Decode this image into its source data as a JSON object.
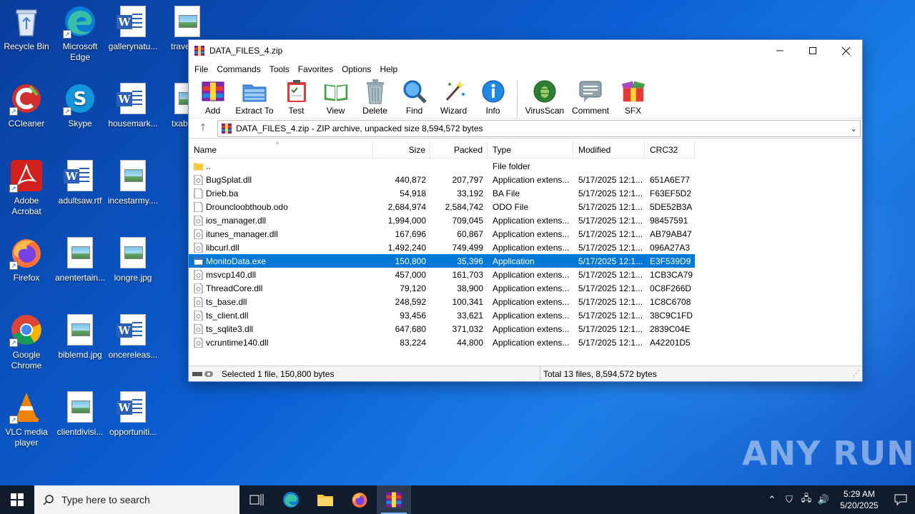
{
  "desktop": {
    "icons": [
      {
        "label": "Recycle Bin"
      },
      {
        "label": "Microsoft Edge"
      },
      {
        "label": "gallerynatu..."
      },
      {
        "label": "travelp..."
      },
      {
        "label": "CCleaner"
      },
      {
        "label": "Skype"
      },
      {
        "label": "housemark..."
      },
      {
        "label": "txabilit..."
      },
      {
        "label": "Adobe Acrobat"
      },
      {
        "label": "adultsaw.rtf"
      },
      {
        "label": "incestarmy...."
      },
      {
        "label": "Firefox"
      },
      {
        "label": "anentertain..."
      },
      {
        "label": "longre.jpg"
      },
      {
        "label": "Google Chrome"
      },
      {
        "label": "biblemd.jpg"
      },
      {
        "label": "oncereleas..."
      },
      {
        "label": "VLC media player"
      },
      {
        "label": "clientdivisi..."
      },
      {
        "label": "opportuniti..."
      }
    ]
  },
  "window": {
    "title": "DATA_FILES_4.zip",
    "menu": [
      "File",
      "Commands",
      "Tools",
      "Favorites",
      "Options",
      "Help"
    ],
    "toolbar": [
      "Add",
      "Extract To",
      "Test",
      "View",
      "Delete",
      "Find",
      "Wizard",
      "Info",
      "VirusScan",
      "Comment",
      "SFX"
    ],
    "address": "DATA_FILES_4.zip - ZIP archive, unpacked size 8,594,572 bytes",
    "columns": {
      "name": "Name",
      "size": "Size",
      "packed": "Packed",
      "type": "Type",
      "modified": "Modified",
      "crc": "CRC32"
    },
    "files": [
      {
        "name": "..",
        "size": "",
        "packed": "",
        "type": "File folder",
        "modified": "",
        "crc": "",
        "icon": "folder-icon"
      },
      {
        "name": "BugSplat.dll",
        "size": "440,872",
        "packed": "207,797",
        "type": "Application extens...",
        "modified": "5/17/2025 12:1...",
        "crc": "651A6E77",
        "icon": "dll-file-icon"
      },
      {
        "name": "Drieb.ba",
        "size": "54,918",
        "packed": "33,192",
        "type": "BA File",
        "modified": "5/17/2025 12:1...",
        "crc": "F63EF5D2",
        "icon": "generic-file-icon"
      },
      {
        "name": "Drouncloobthoub.odo",
        "size": "2,684,974",
        "packed": "2,584,742",
        "type": "ODO File",
        "modified": "5/17/2025 12:1...",
        "crc": "5DE52B3A",
        "icon": "generic-file-icon"
      },
      {
        "name": "ios_manager.dll",
        "size": "1,994,000",
        "packed": "709,045",
        "type": "Application extens...",
        "modified": "5/17/2025 12:1...",
        "crc": "98457591",
        "icon": "dll-file-icon"
      },
      {
        "name": "itunes_manager.dll",
        "size": "167,696",
        "packed": "60,867",
        "type": "Application extens...",
        "modified": "5/17/2025 12:1...",
        "crc": "AB79AB47",
        "icon": "dll-file-icon"
      },
      {
        "name": "libcurl.dll",
        "size": "1,492,240",
        "packed": "749,499",
        "type": "Application extens...",
        "modified": "5/17/2025 12:1...",
        "crc": "096A27A3",
        "icon": "dll-file-icon"
      },
      {
        "name": "MonitoData.exe",
        "size": "150,800",
        "packed": "35,396",
        "type": "Application",
        "modified": "5/17/2025 12:1...",
        "crc": "E3F539D9",
        "icon": "exe-file-icon",
        "selected": true
      },
      {
        "name": "msvcp140.dll",
        "size": "457,000",
        "packed": "161,703",
        "type": "Application extens...",
        "modified": "5/17/2025 12:1...",
        "crc": "1CB3CA79",
        "icon": "dll-file-icon"
      },
      {
        "name": "ThreadCore.dll",
        "size": "79,120",
        "packed": "38,900",
        "type": "Application extens...",
        "modified": "5/17/2025 12:1...",
        "crc": "0C8F266D",
        "icon": "dll-file-icon"
      },
      {
        "name": "ts_base.dll",
        "size": "248,592",
        "packed": "100,341",
        "type": "Application extens...",
        "modified": "5/17/2025 12:1...",
        "crc": "1C8C6708",
        "icon": "dll-file-icon"
      },
      {
        "name": "ts_client.dll",
        "size": "93,456",
        "packed": "33,621",
        "type": "Application extens...",
        "modified": "5/17/2025 12:1...",
        "crc": "38C9C1FD",
        "icon": "dll-file-icon"
      },
      {
        "name": "ts_sqlite3.dll",
        "size": "647,680",
        "packed": "371,032",
        "type": "Application extens...",
        "modified": "5/17/2025 12:1...",
        "crc": "2839C04E",
        "icon": "dll-file-icon"
      },
      {
        "name": "vcruntime140.dll",
        "size": "83,224",
        "packed": "44,800",
        "type": "Application extens...",
        "modified": "5/17/2025 12:1...",
        "crc": "A42201D5",
        "icon": "dll-file-icon"
      }
    ],
    "status_left": "Selected 1 file, 150,800 bytes",
    "status_right": "Total 13 files, 8,594,572 bytes"
  },
  "taskbar": {
    "search_placeholder": "Type here to search",
    "time": "5:29 AM",
    "date": "5/20/2025"
  },
  "watermark": "ANY RUN",
  "colors": {
    "selection": "#0078d7",
    "taskbar": "#101c2c"
  }
}
